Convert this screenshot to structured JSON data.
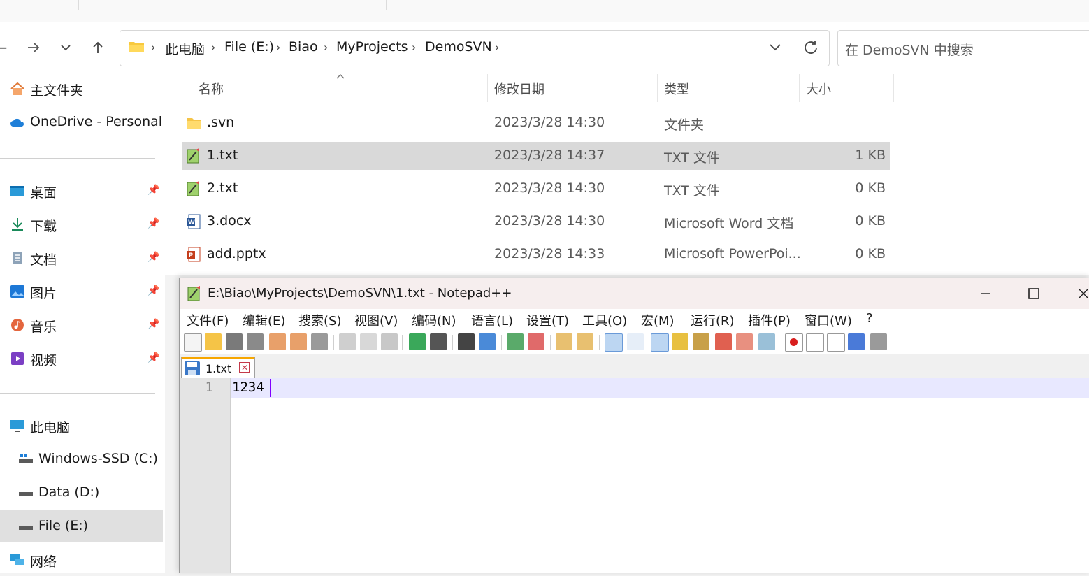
{
  "explorer": {
    "address": {
      "crumbs": [
        "此电脑",
        "File (E:)",
        "Biao",
        "MyProjects",
        "DemoSVN"
      ],
      "separator": "›"
    },
    "search_placeholder": "在 DemoSVN 中搜索",
    "sidebar": {
      "quick": [
        {
          "label": "主文件夹",
          "icon": "home-icon"
        },
        {
          "label": "OneDrive - Personal",
          "icon": "cloud-icon"
        }
      ],
      "pinned": [
        {
          "label": "桌面",
          "icon": "desktop-icon"
        },
        {
          "label": "下载",
          "icon": "download-icon"
        },
        {
          "label": "文档",
          "icon": "document-icon"
        },
        {
          "label": "图片",
          "icon": "pictures-icon"
        },
        {
          "label": "音乐",
          "icon": "music-icon"
        },
        {
          "label": "视频",
          "icon": "video-icon"
        }
      ],
      "this_pc": {
        "label": "此电脑",
        "icon": "computer-icon"
      },
      "drives": [
        {
          "label": "Windows-SSD (C:)",
          "icon": "drive-icon"
        },
        {
          "label": "Data (D:)",
          "icon": "drive-icon"
        },
        {
          "label": "File (E:)",
          "icon": "drive-icon",
          "selected": true
        }
      ],
      "network": {
        "label": "网络",
        "icon": "network-icon"
      }
    },
    "columns": {
      "name": "名称",
      "modified": "修改日期",
      "type": "类型",
      "size": "大小"
    },
    "files": [
      {
        "name": ".svn",
        "modified": "2023/3/28 14:30",
        "type": "文件夹",
        "size": "",
        "icon": "folder-icon"
      },
      {
        "name": "1.txt",
        "modified": "2023/3/28 14:37",
        "type": "TXT 文件",
        "size": "1 KB",
        "icon": "notepadpp-file-icon",
        "selected": true
      },
      {
        "name": "2.txt",
        "modified": "2023/3/28 14:30",
        "type": "TXT 文件",
        "size": "0 KB",
        "icon": "notepadpp-file-icon"
      },
      {
        "name": "3.docx",
        "modified": "2023/3/28 14:30",
        "type": "Microsoft Word 文档",
        "size": "0 KB",
        "icon": "word-doc-icon"
      },
      {
        "name": "add.pptx",
        "modified": "2023/3/28 14:33",
        "type": "Microsoft PowerPoi...",
        "size": "0 KB",
        "icon": "powerpoint-icon"
      }
    ]
  },
  "notepad": {
    "title": "E:\\Biao\\MyProjects\\DemoSVN\\1.txt - Notepad++",
    "menu": [
      "文件(F)",
      "编辑(E)",
      "搜索(S)",
      "视图(V)",
      "编码(N)",
      "语言(L)",
      "设置(T)",
      "工具(O)",
      "宏(M)",
      "运行(R)",
      "插件(P)",
      "窗口(W)",
      "?"
    ],
    "tab": {
      "label": "1.txt"
    },
    "lines": [
      {
        "number": "1",
        "text": "1234"
      }
    ],
    "colors": {
      "current_line": "#e8e8ff",
      "caret": "#8000ff",
      "tab_accent": "#f7a600"
    }
  }
}
